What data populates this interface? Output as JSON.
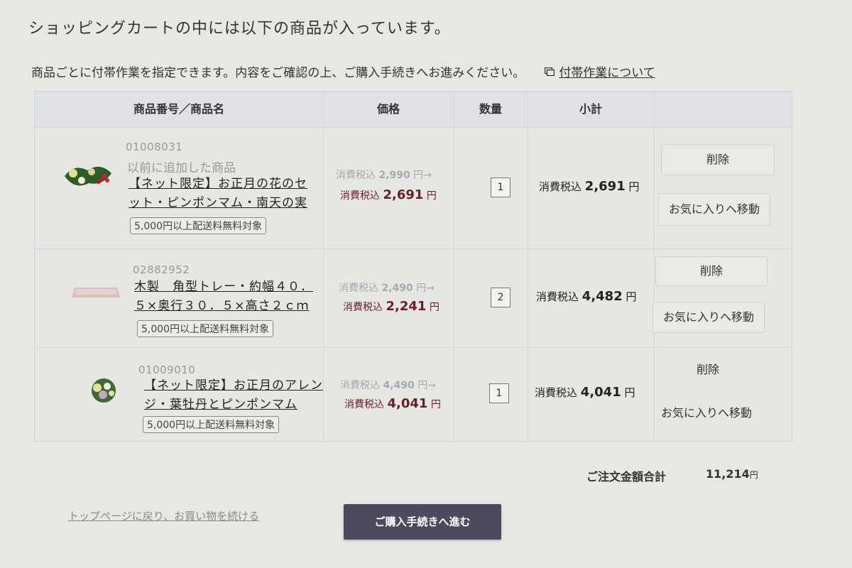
{
  "page": {
    "title": "ショッピングカートの中には以下の商品が入っています。",
    "intro": "商品ごとに付帯作業を指定できます。内容をご確認の上、ご購入手続きへお進みください。",
    "help_link": "付帯作業について"
  },
  "table": {
    "headers": {
      "product": "商品番号／商品名",
      "price": "価格",
      "quantity": "数量",
      "subtotal": "小計"
    }
  },
  "items": [
    {
      "code": "01008031",
      "note": "以前に追加した商品",
      "name_line1": "【ネット限定】お正月の花のセ",
      "name_line2": "ット・ピンポンマム・南天の実",
      "badge": "5,000円以上配送料無料対象",
      "old_price_label": "消費税込",
      "old_price": "2,990",
      "old_price_suffix": "円→",
      "new_price_label": "消費税込",
      "new_price": "2,691",
      "new_price_suffix": "円",
      "qty": "1",
      "subtotal_label": "消費税込",
      "subtotal": "2,691",
      "subtotal_suffix": "円",
      "delete_label": "削除",
      "favorite_label": "お気に入りへ移動"
    },
    {
      "code": "02882952",
      "name_line1": "木製　角型トレー・約幅４０．",
      "name_line2": "５×奥行３０．５×高さ２ｃｍ",
      "badge": "5,000円以上配送料無料対象",
      "old_price_label": "消費税込",
      "old_price": "2,490",
      "old_price_suffix": "円→",
      "new_price_label": "消費税込",
      "new_price": "2,241",
      "new_price_suffix": "円",
      "qty": "2",
      "subtotal_label": "消費税込",
      "subtotal": "4,482",
      "subtotal_suffix": "円",
      "delete_label": "削除",
      "favorite_label": "お気に入りへ移動"
    },
    {
      "code": "01009010",
      "name_line1": "【ネット限定】お正月のアレン",
      "name_line2": "ジ・葉牡丹とピンポンマム",
      "badge": "5,000円以上配送料無料対象",
      "old_price_label": "消費税込",
      "old_price": "4,490",
      "old_price_suffix": "円→",
      "new_price_label": "消費税込",
      "new_price": "4,041",
      "new_price_suffix": "円",
      "qty": "1",
      "subtotal_label": "消費税込",
      "subtotal": "4,041",
      "subtotal_suffix": "円",
      "delete_label": "削除",
      "favorite_label": "お気に入りへ移動"
    }
  ],
  "summary": {
    "total_label": "ご注文金額合計",
    "total_value": "11,214",
    "total_suffix": "円"
  },
  "footer": {
    "back_link": "トップページに戻り、お買い物を続ける",
    "checkout_label": "ご購入手続きへ進む"
  },
  "colors": {
    "checkout_bg": "#4e4a5e",
    "price_accent": "#6b1e2a",
    "old_price": "#a5a9b3"
  },
  "icons": {
    "help": "window-icon"
  }
}
